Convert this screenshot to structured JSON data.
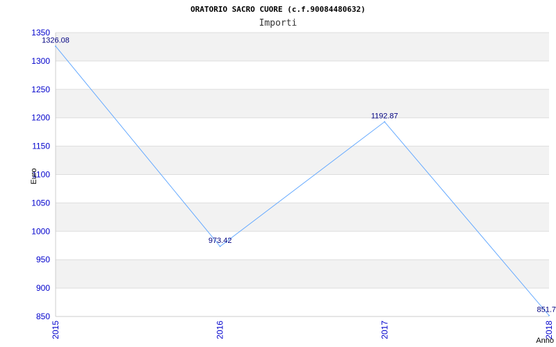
{
  "chart_data": {
    "type": "line",
    "title": "ORATORIO SACRO CUORE (c.f.90084480632)",
    "subtitle": "Importi",
    "xlabel": "Anno",
    "ylabel": "Euro",
    "categories": [
      "2015",
      "2016",
      "2017",
      "2018"
    ],
    "series": [
      {
        "values": [
          1326.08,
          973.42,
          1192.87,
          851.7
        ]
      }
    ],
    "data_labels": [
      "1326.08",
      "973.42",
      "1192.87",
      "851.7"
    ],
    "ylim": [
      850,
      1350
    ],
    "yticks": [
      850,
      900,
      950,
      1000,
      1050,
      1100,
      1150,
      1200,
      1250,
      1300,
      1350
    ],
    "grid": true,
    "legend": "none",
    "colors": {
      "line": "#66aaff",
      "band": "#f2f2f2",
      "tick_text": "#0000cc",
      "data_label": "#000080"
    }
  }
}
